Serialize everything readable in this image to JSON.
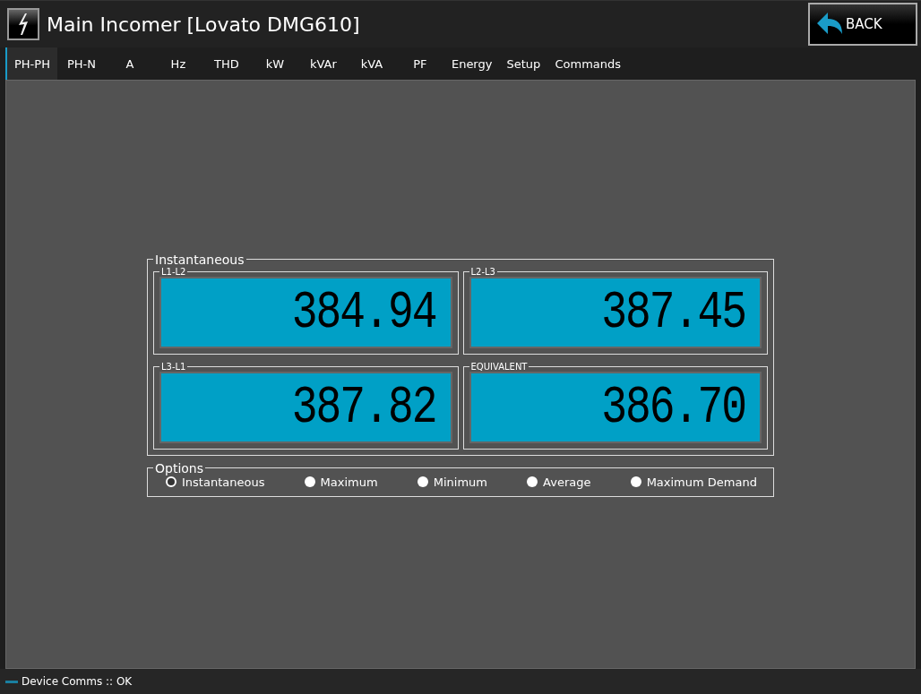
{
  "window": {
    "title": "Main Incomer [Lovato DMG610]"
  },
  "back_button": {
    "label": "BACK"
  },
  "tabs": [
    {
      "label": "PH-PH",
      "selected": true
    },
    {
      "label": "PH-N",
      "selected": false
    },
    {
      "label": "A",
      "selected": false
    },
    {
      "label": "Hz",
      "selected": false
    },
    {
      "label": "THD",
      "selected": false
    },
    {
      "label": "kW",
      "selected": false
    },
    {
      "label": "kVAr",
      "selected": false
    },
    {
      "label": "kVA",
      "selected": false
    },
    {
      "label": "PF",
      "selected": false
    },
    {
      "label": "Energy",
      "selected": false
    },
    {
      "label": "Setup",
      "selected": false
    },
    {
      "label": "Commands",
      "selected": false
    }
  ],
  "readings": {
    "title": "Instantaneous",
    "items": [
      {
        "label": "L1-L2",
        "value": "384.94"
      },
      {
        "label": "L2-L3",
        "value": "387.45"
      },
      {
        "label": "L3-L1",
        "value": "387.82"
      },
      {
        "label": "EQUIVALENT",
        "value": "386.70"
      }
    ]
  },
  "options": {
    "title": "Options",
    "items": [
      {
        "label": "Instantaneous",
        "selected": true
      },
      {
        "label": "Maximum",
        "selected": false
      },
      {
        "label": "Minimum",
        "selected": false
      },
      {
        "label": "Average",
        "selected": false
      },
      {
        "label": "Maximum Demand",
        "selected": false
      }
    ]
  },
  "status_bar": {
    "text": "Device Comms :: OK"
  }
}
